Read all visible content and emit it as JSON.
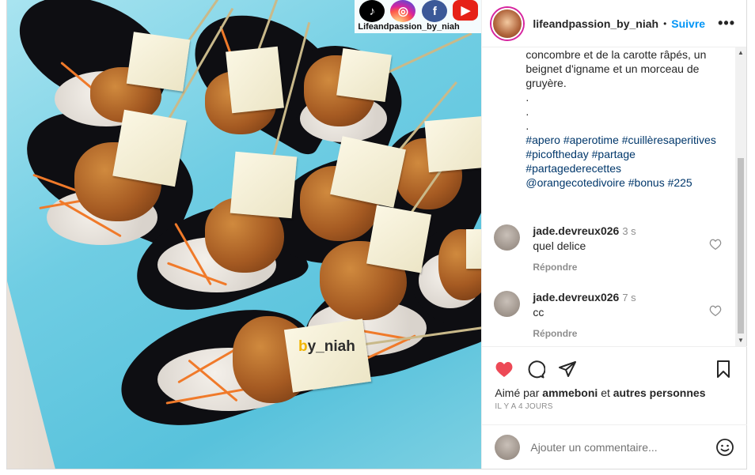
{
  "post": {
    "username": "lifeandpassion_by_niah",
    "separator": "•",
    "follow_label": "Suivre",
    "more_label": "•••"
  },
  "image": {
    "brand_text": "Lifeandpassion_by_niah",
    "watermark_letter": "b",
    "watermark_rest": "y_niah",
    "social_icons": [
      "tiktok-icon",
      "instagram-icon",
      "facebook-icon",
      "youtube-icon"
    ]
  },
  "caption": {
    "line1": "concombre et de la carotte râpés, un",
    "line2": "beignet d'igname et un morceau de",
    "line3": "gruyère.",
    "dot1": ".",
    "dot2": ".",
    "dot3": ".",
    "tags1": "#apero #aperotime #cuillèresaperitives",
    "tags2": "#picoftheday #partage",
    "tags3": "#partagederecettes",
    "tags4": "@orangecotedivoire #bonus #225"
  },
  "comments": [
    {
      "user": "jade.devreux026",
      "time": "3 s",
      "text": "quel delice",
      "reply": "Répondre"
    },
    {
      "user": "jade.devreux026",
      "time": "7 s",
      "text": "cc",
      "reply": "Répondre"
    }
  ],
  "likes": {
    "prefix": "Aimé par",
    "user": "ammeboni",
    "conj": "et",
    "others": "autres personnes"
  },
  "timestamp": "IL Y A 4 JOURS",
  "add_comment": {
    "placeholder": "Ajouter un commentaire..."
  },
  "colors": {
    "accent": "#0095f6",
    "like": "#ed4956",
    "hashtag": "#00376b"
  }
}
